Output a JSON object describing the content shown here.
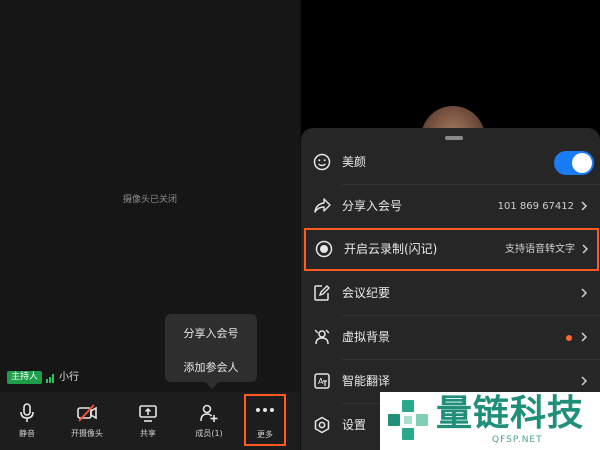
{
  "left": {
    "camera_status": "摄像头已关闭",
    "popover": {
      "items": [
        "分享入会号",
        "添加参会人"
      ]
    },
    "host_badge": "主持人",
    "host_name": "小行",
    "toolbar": [
      {
        "label": "静音",
        "icon": "microphone-icon"
      },
      {
        "label": "开摄像头",
        "icon": "camera-off-icon"
      },
      {
        "label": "共享",
        "icon": "screen-share-icon"
      },
      {
        "label": "成员(1)",
        "icon": "add-member-icon"
      },
      {
        "label": "更多",
        "icon": "more-icon"
      }
    ]
  },
  "right": {
    "menu": [
      {
        "label": "美颜",
        "icon": "beauty-face-icon",
        "toggle_on": true
      },
      {
        "label": "分享入会号",
        "icon": "share-icon",
        "value": "101 869 67412"
      },
      {
        "label": "开启云录制(闪记)",
        "icon": "record-icon",
        "value": "支持语音转文字"
      },
      {
        "label": "会议纪要",
        "icon": "notes-icon"
      },
      {
        "label": "虚拟背景",
        "icon": "virtual-background-icon"
      },
      {
        "label": "智能翻译",
        "icon": "translate-icon"
      },
      {
        "label": "设置",
        "icon": "settings-icon"
      }
    ]
  },
  "watermark": {
    "title": "量链科技",
    "subtitle": "QFSP.NET"
  },
  "colors": {
    "accent_blue": "#1a7cf5",
    "highlight_orange": "#ff5a1f",
    "host_green": "#1e9e4a",
    "brand_teal": "#1f8f7a"
  }
}
